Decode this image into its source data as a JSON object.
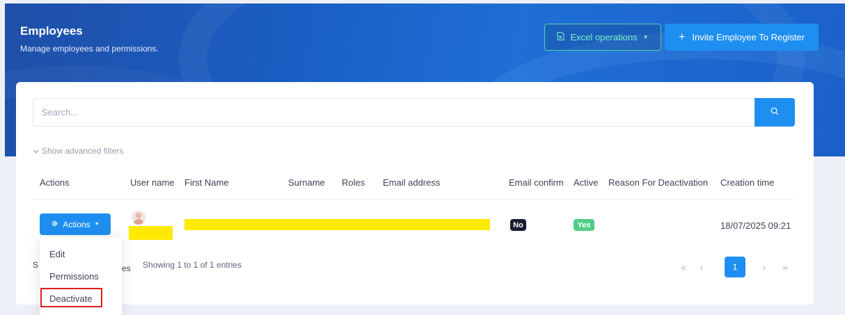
{
  "header": {
    "title": "Employees",
    "subtitle": "Manage employees and permissions.",
    "excel_button": "Excel operations",
    "invite_button": "Invite Employee To Register"
  },
  "search": {
    "placeholder": "Search...",
    "advanced_filters": "Show advanced filters"
  },
  "table": {
    "columns": [
      "Actions",
      "User name",
      "First Name",
      "Surname",
      "Roles",
      "Email address",
      "Email confirm",
      "Active",
      "Reason For Deactivation",
      "Creation time"
    ],
    "rows": [
      {
        "actions_label": "Actions",
        "email_confirm": "No",
        "active": "Yes",
        "creation_time": "18/07/2025 09:21"
      }
    ]
  },
  "footer": {
    "showing": "Showing 1 to 1 of 1 entries",
    "page_size_start": "S",
    "page_size_end": "es"
  },
  "pagination": {
    "first": "«",
    "prev": "‹",
    "current": "1",
    "next": "›",
    "last": "»"
  },
  "actions_menu": {
    "items": [
      "Edit",
      "Permissions",
      "Deactivate"
    ],
    "highlighted": "Deactivate"
  },
  "colors": {
    "primary": "#1e8ff0",
    "success": "#50cd89",
    "dark_badge": "#181c32",
    "highlight_border": "#e11d1d",
    "redaction": "#ffea00"
  }
}
